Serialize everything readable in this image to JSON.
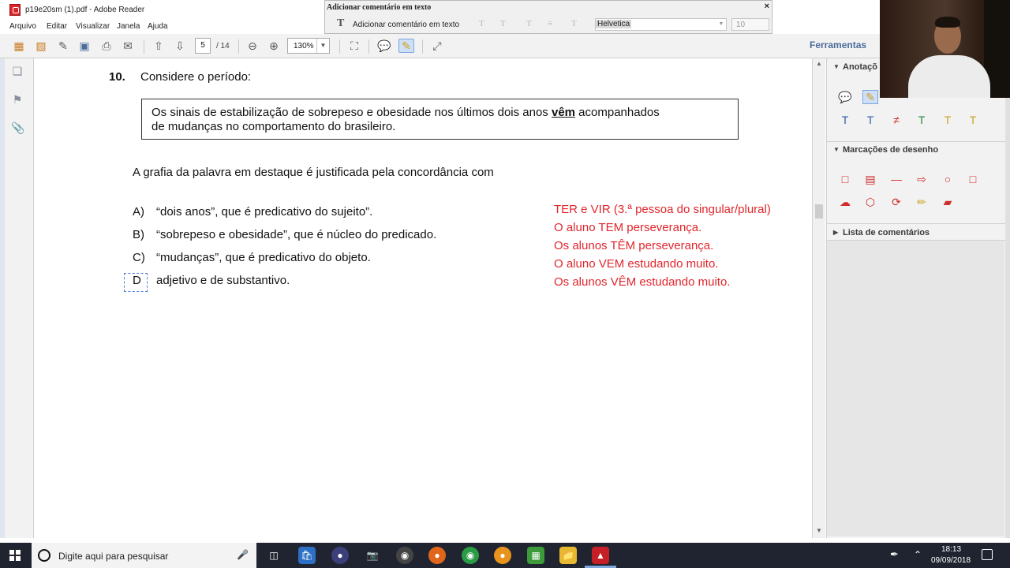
{
  "window": {
    "title": "p19e20sm (1).pdf - Adobe Reader",
    "menu": [
      "Arquivo",
      "Editar",
      "Visualizar",
      "Janela",
      "Ajuda"
    ]
  },
  "toolbar": {
    "page_current": "5",
    "page_total": "/ 14",
    "zoom": "130%",
    "tools_label": "Ferramentas",
    "icons": [
      "create-pdf-icon",
      "open-icon",
      "edit-icon",
      "save-icon",
      "print-icon",
      "email-icon",
      "prev-page-icon",
      "next-page-icon",
      "zoom-out-icon",
      "zoom-in-icon",
      "fit-page-icon",
      "sticky-note-icon",
      "add-text-comment-icon",
      "expand-icon"
    ]
  },
  "comment_toolbar": {
    "title": "Adicionar comentário em texto",
    "close": "×",
    "tool_label": "Adicionar comentário em texto",
    "font": "Helvetica",
    "size": "10"
  },
  "document": {
    "question_number": "10.",
    "question_head": "Considere o período:",
    "quote_line1_before": "Os sinais de estabilização de sobrepeso e obesidade nos últimos dois anos ",
    "quote_highlight": "vêm",
    "quote_line1_after": " acompanhados",
    "quote_line2": "de mudanças no comportamento do brasileiro.",
    "stem": "A grafia da palavra em destaque é justificada pela concordância com",
    "options": [
      {
        "letter": "A)",
        "text": "“dois anos”, que é predicativo do sujeito”."
      },
      {
        "letter": "B)",
        "text": "“sobrepeso e obesidade”, que é núcleo do predicado."
      },
      {
        "letter": "C)",
        "text": "“mudanças”, que é predicativo do objeto."
      },
      {
        "letter": "D",
        "text": "adjetivo e de substantivo."
      }
    ],
    "notes": [
      "TER e VIR (3.ª pessoa do singular/plural)",
      "O aluno TEM perseverança.",
      "Os alunos TÊM perseverança.",
      "O aluno VEM estudando muito.",
      "Os alunos VÊM estudando muito."
    ],
    "note_color": "#e0262c"
  },
  "right_panel": {
    "annotations_title": "Anotaçõ",
    "drawing_title": "Marcações de desenho",
    "comments_title": "Lista de comentários"
  },
  "taskbar": {
    "search_placeholder": "Digite aqui para pesquisar",
    "time": "18:13",
    "date": "09/09/2018"
  }
}
